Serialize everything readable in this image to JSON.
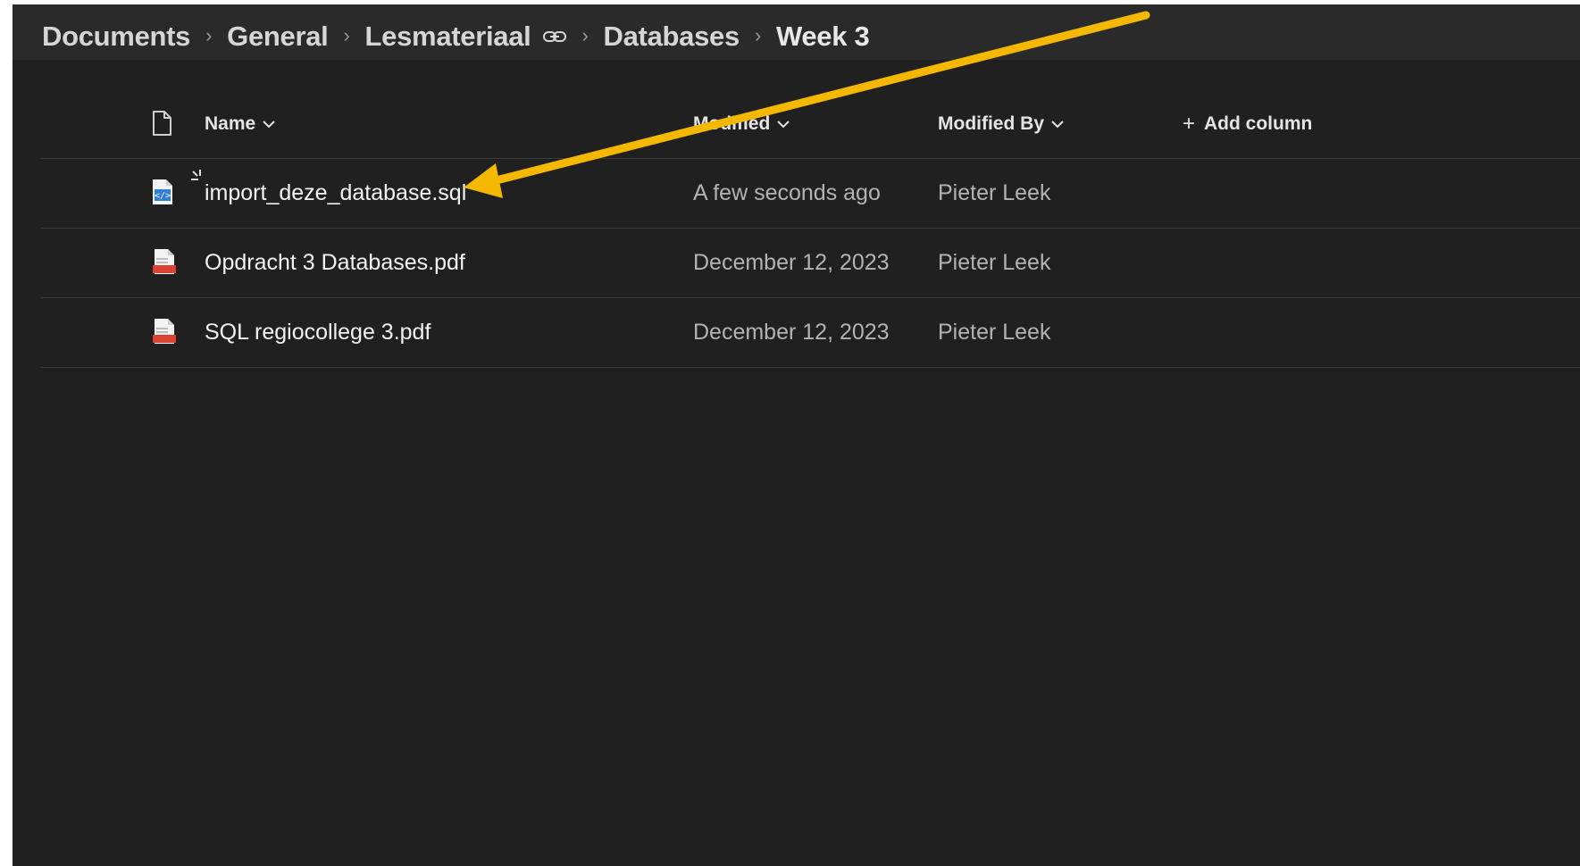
{
  "breadcrumb": {
    "items": [
      "Documents",
      "General",
      "Lesmateriaal",
      "Databases",
      "Week 3"
    ]
  },
  "columns": {
    "name": "Name",
    "modified": "Modified",
    "modified_by": "Modified By",
    "add_column": "Add column"
  },
  "files": [
    {
      "name": "import_deze_database.sql",
      "modified": "A few seconds ago",
      "modified_by": "Pieter Leek",
      "icon": "code-file-icon"
    },
    {
      "name": "Opdracht 3 Databases.pdf",
      "modified": "December 12, 2023",
      "modified_by": "Pieter Leek",
      "icon": "pdf-file-icon"
    },
    {
      "name": "SQL regiocollege 3.pdf",
      "modified": "December 12, 2023",
      "modified_by": "Pieter Leek",
      "icon": "pdf-file-icon"
    }
  ],
  "colors": {
    "background": "#202020",
    "topbar": "#2a2a2a",
    "annotation_arrow": "#F5B800",
    "pdf_icon": "#D9432F",
    "code_icon": "#2F7FD9"
  }
}
